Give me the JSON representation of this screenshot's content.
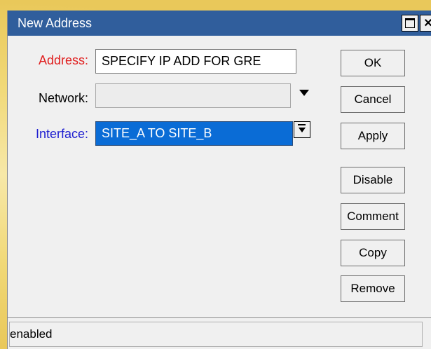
{
  "window": {
    "title": "New Address"
  },
  "form": {
    "address": {
      "label": "Address:",
      "value": "SPECIFY IP ADD FOR GRE",
      "label_color": "#e02020"
    },
    "network": {
      "label": "Network:",
      "value": ""
    },
    "interface": {
      "label": "Interface:",
      "value": "SITE_A TO SITE_B",
      "label_color": "#2020d0"
    }
  },
  "buttons": {
    "ok": "OK",
    "cancel": "Cancel",
    "apply": "Apply",
    "disable": "Disable",
    "comment": "Comment",
    "copy": "Copy",
    "remove": "Remove"
  },
  "status": {
    "text": "enabled"
  },
  "colors": {
    "titlebar": "#305e9c",
    "selection": "#0a6cd6"
  }
}
